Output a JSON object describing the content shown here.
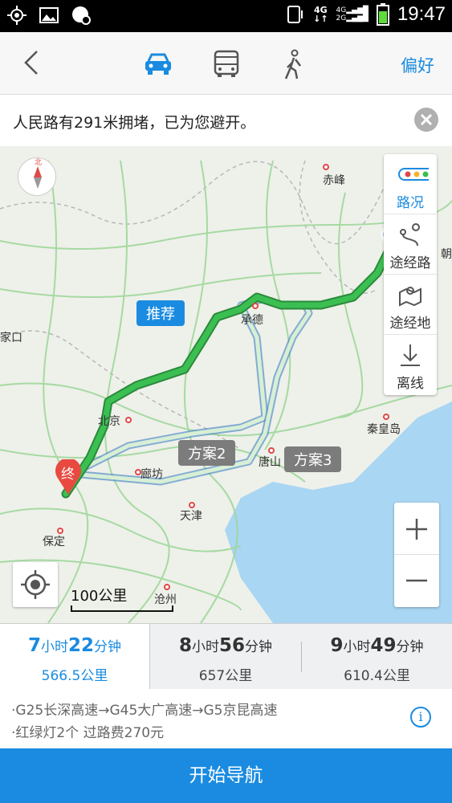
{
  "status_bar": {
    "network_top": "4G",
    "network_2g": "2G",
    "clock": "19:47"
  },
  "nav": {
    "modes": [
      "car-icon",
      "bus-icon",
      "walk-icon"
    ],
    "active_mode": "car",
    "preference_label": "偏好",
    "accent_color": "#1a8be0"
  },
  "banner": {
    "text": "人民路有291米拥堵，已为您避开。"
  },
  "map": {
    "compass_label": "北",
    "cities": [
      "赤峰",
      "承德",
      "北京",
      "廊坊",
      "天津",
      "唐山",
      "秦皇岛",
      "保定",
      "沧州",
      "家口",
      "朝"
    ],
    "route_tags": {
      "recommended": "推荐",
      "plan2": "方案2",
      "plan3": "方案3"
    },
    "end_marker": "终",
    "scale_label": "100公里",
    "traffic_colors": {
      "smooth": "#3cbf52",
      "slow": "#f5b531",
      "jam": "#e04848"
    }
  },
  "side_panel": {
    "traffic": "路况",
    "via_route": "途经路",
    "via_place": "途经地",
    "offline": "离线"
  },
  "zoom": {
    "plus": "+",
    "minus": "−"
  },
  "options": [
    {
      "h": "7",
      "h_unit": "小时",
      "m": "22",
      "m_unit": "分钟",
      "distance": "566.5公里"
    },
    {
      "h": "8",
      "h_unit": "小时",
      "m": "56",
      "m_unit": "分钟",
      "distance": "657公里"
    },
    {
      "h": "9",
      "h_unit": "小时",
      "m": "49",
      "m_unit": "分钟",
      "distance": "610.4公里"
    }
  ],
  "route_info": {
    "roads": "·G25长深高速→G45大广高速→G5京昆高速",
    "details": "·红绿灯2个  过路费270元"
  },
  "start_button": "开始导航"
}
